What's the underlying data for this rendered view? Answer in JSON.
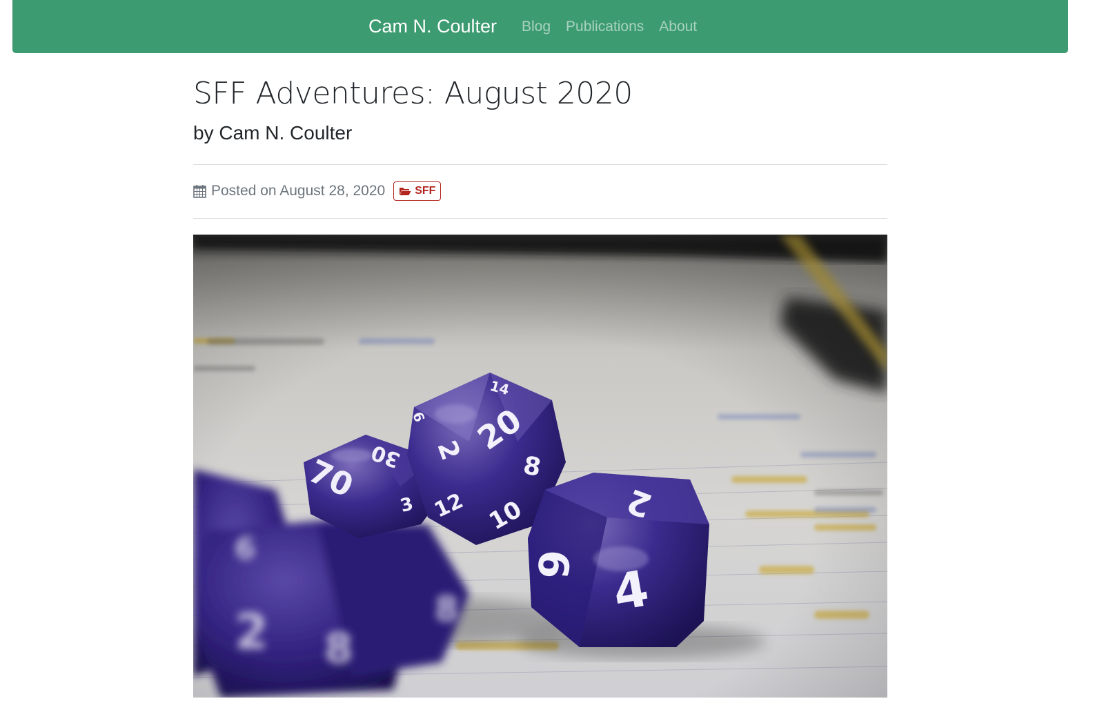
{
  "nav": {
    "brand": "Cam N. Coulter",
    "links": [
      {
        "label": "Blog"
      },
      {
        "label": "Publications"
      },
      {
        "label": "About"
      }
    ]
  },
  "post": {
    "title": "SFF Adventures: August 2020",
    "byline": "by Cam N. Coulter",
    "posted_on": "Posted on August 28, 2020",
    "category": "SFF",
    "hero_image": "purple polyhedral dice on lined notebook paper"
  },
  "colors": {
    "navbar": "#3d9b71",
    "badge": "#b3261e",
    "dice": "#3a2a8a"
  },
  "icons": {
    "calendar": "calendar-icon",
    "folder": "folder-open-icon"
  }
}
